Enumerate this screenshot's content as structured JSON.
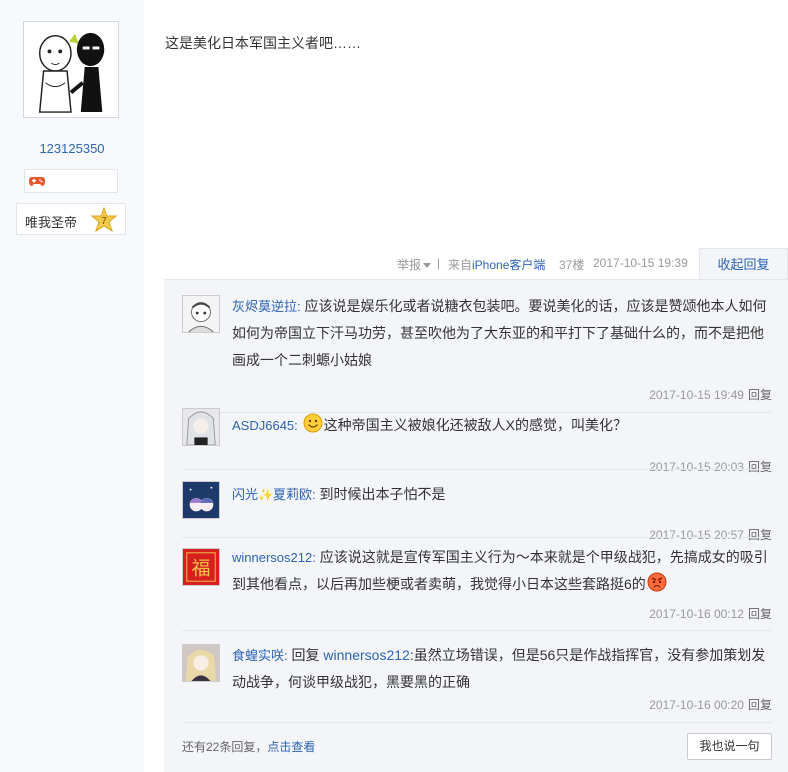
{
  "author": {
    "name": "123125350",
    "level_name": "唯我圣帝",
    "level_number": "7"
  },
  "post": {
    "content": "这是美化日本军国主义者吧……",
    "report_label": "举报",
    "separator": "|",
    "client_prefix": "来自",
    "client_name": "iPhone客户端",
    "floor": "37楼",
    "time": "2017-10-15 19:39",
    "collapse_label": "收起回复"
  },
  "replies": [
    {
      "user": "灰烬莫逆拉",
      "colon": ":",
      "text": "应该说是娱乐化或者说糖衣包装吧。要说美化的话，应该是赞颂他本人如何如何为帝国立下汗马功劳，甚至吹他为了大东亚的和平打下了基础什么的，而不是把他画成一个二刺螈小姑娘",
      "time": "2017-10-15 19:49",
      "reply_label": "回复"
    },
    {
      "user": "ASDJ6645",
      "colon": ":",
      "text": "这种帝国主义被娘化还被敌人X的感觉，叫美化？",
      "time": "2017-10-15 20:03",
      "reply_label": "回复"
    },
    {
      "user_part1": "闪光",
      "user_sparkle": "✨",
      "user_part2": "夏莉欧",
      "colon": ":",
      "text": "到时候出本子怕不是",
      "time": "2017-10-15 20:57",
      "reply_label": "回复"
    },
    {
      "user": "winnersos212",
      "colon": ":",
      "text": "应该说这就是宣传军国主义行为～本来就是个甲级战犯，先搞成女的吸引到其他看点，以后再加些梗或者卖萌，我觉得小日本这些套路挺6的",
      "time": "2017-10-16 00:12",
      "reply_label": "回复"
    },
    {
      "user": "食蝗实咲",
      "colon": ":",
      "reply_prefix": "回复",
      "mention": "winnersos212",
      "text": ":虽然立场错误，但是56只是作战指挥官，没有参加策划发动战争，何谈甲级战犯，黑要黑的正确",
      "time": "2017-10-16 00:20",
      "reply_label": "回复"
    }
  ],
  "more": {
    "prefix": "还有22条回复，",
    "link": "点击查看"
  },
  "say_button": "我也说一句",
  "colors": {
    "link": "#2d64b3",
    "muted": "#999999",
    "panel": "#f3f5f8",
    "sidebar": "#f7f9fc"
  }
}
